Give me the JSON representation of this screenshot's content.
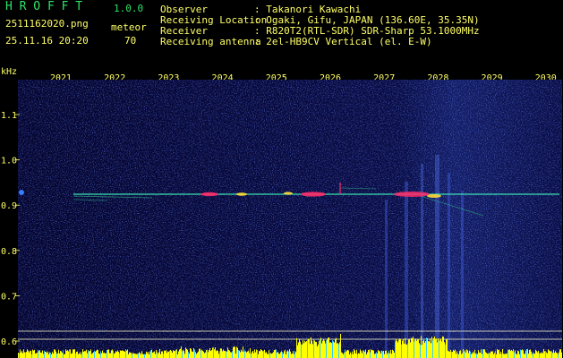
{
  "app": {
    "logo": "H R O F F T",
    "version": "1.0.0",
    "filename": "2511162020.png",
    "datetime": "25.11.16 20:20",
    "meteor_label": "meteor",
    "meteor_count": "70"
  },
  "info": {
    "rows": [
      {
        "label": "Observer",
        "value": ": Takanori Kawachi"
      },
      {
        "label": "Receiving Location",
        "value": ": Ogaki, Gifu, JAPAN (136.60E, 35.35N)"
      },
      {
        "label": "Receiver",
        "value": ": R820T2(RTL-SDR) SDR-Sharp 53.1000MHz"
      },
      {
        "label": "Receiving antenna",
        "value": ": 2el-HB9CV Vertical (el. E-W)"
      }
    ]
  },
  "axis": {
    "unit": "kHz",
    "x_ticks": [
      "2021",
      "2022",
      "2023",
      "2024",
      "2025",
      "2026",
      "2027",
      "2028",
      "2029",
      "2030"
    ],
    "y_ticks": [
      "1.1",
      "1.0",
      "0.9",
      "0.8",
      "0.7",
      "0.6"
    ]
  },
  "colors": {
    "background": "#000000",
    "plot_bg": "#0a0a3a",
    "label_yellow": "#ffff66",
    "header_green": "#2fe36a",
    "carrier": "#38e0b0",
    "meteor_hot": "#ff2a6a",
    "histogram": "#ffff00"
  }
}
